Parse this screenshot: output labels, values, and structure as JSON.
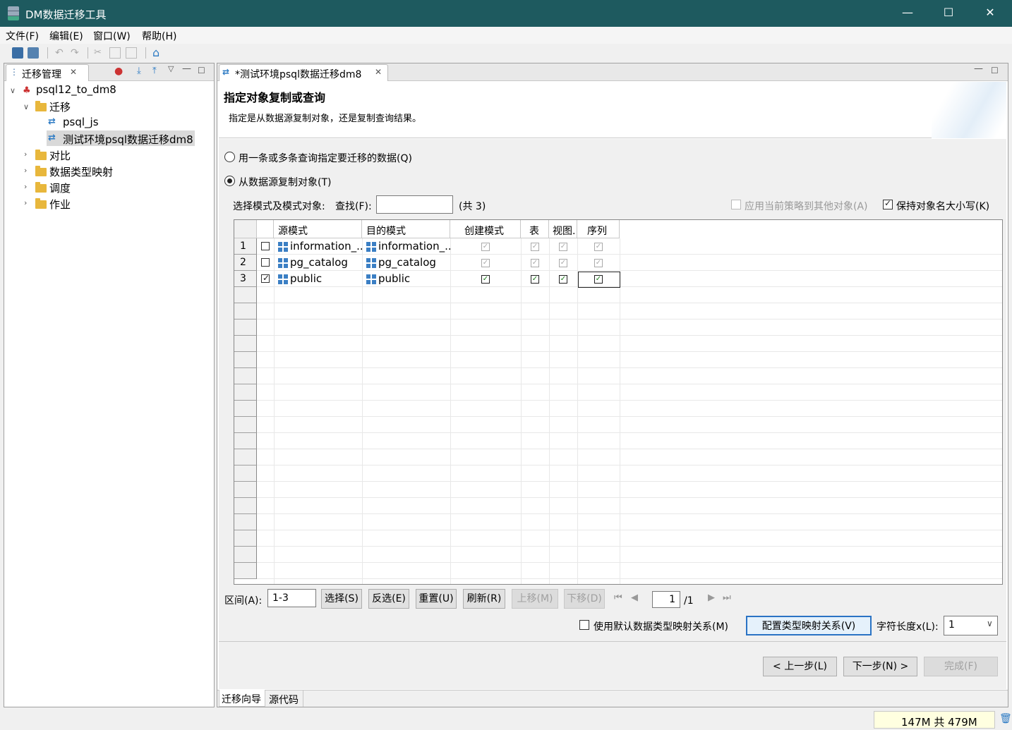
{
  "window": {
    "title": "DM数据迁移工具",
    "min": "—",
    "max": "☐",
    "close": "✕"
  },
  "menu": [
    "文件(F)",
    "编辑(E)",
    "窗口(W)",
    "帮助(H)"
  ],
  "left": {
    "tab": "迁移管理",
    "tree": {
      "root": "psql12_to_dm8",
      "migrate": "迁移",
      "item1": "psql_js",
      "item2": "测试环境psql数据迁移dm8",
      "compare": "对比",
      "typemap": "数据类型映射",
      "schedule": "调度",
      "job": "作业"
    }
  },
  "editor": {
    "tab": "*测试环境psql数据迁移dm8",
    "title": "指定对象复制或查询",
    "desc": "指定是从数据源复制对象，还是复制查询结果。",
    "opt_query": "用一条或多条查询指定要迁移的数据(Q)",
    "opt_copy": "从数据源复制对象(T)",
    "select_label": "选择模式及模式对象:",
    "search_label": "查找(F):",
    "count": "(共 3)",
    "apply_policy": "应用当前策略到其他对象(A)",
    "keep_case": "保持对象名大小写(K)",
    "columns": [
      "源模式",
      "目的模式",
      "创建模式",
      "表",
      "视图.",
      "序列"
    ],
    "rows": [
      {
        "n": "1",
        "src": "information_..",
        "dst": "information_..",
        "checked": false
      },
      {
        "n": "2",
        "src": "pg_catalog",
        "dst": "pg_catalog",
        "checked": false
      },
      {
        "n": "3",
        "src": "public",
        "dst": "public",
        "checked": true
      }
    ],
    "range_label": "区间(A):",
    "range_value": "1-3",
    "btn_select": "选择(S)",
    "btn_invert": "反选(E)",
    "btn_reset": "重置(U)",
    "btn_refresh": "刷新(R)",
    "btn_up": "上移(M)",
    "btn_down": "下移(D)",
    "page": "1",
    "pages": "/1",
    "use_default_map": "使用默认数据类型映射关系(M)",
    "btn_config_map": "配置类型映射关系(V)",
    "charlen_label": "字符长度x(L):",
    "charlen_value": "1",
    "btn_prev": "< 上一步(L)",
    "btn_next": "下一步(N) >",
    "btn_finish": "完成(F)",
    "tab_wizard": "迁移向导",
    "tab_source": "源代码"
  },
  "status": {
    "memory": "147M 共 479M"
  }
}
